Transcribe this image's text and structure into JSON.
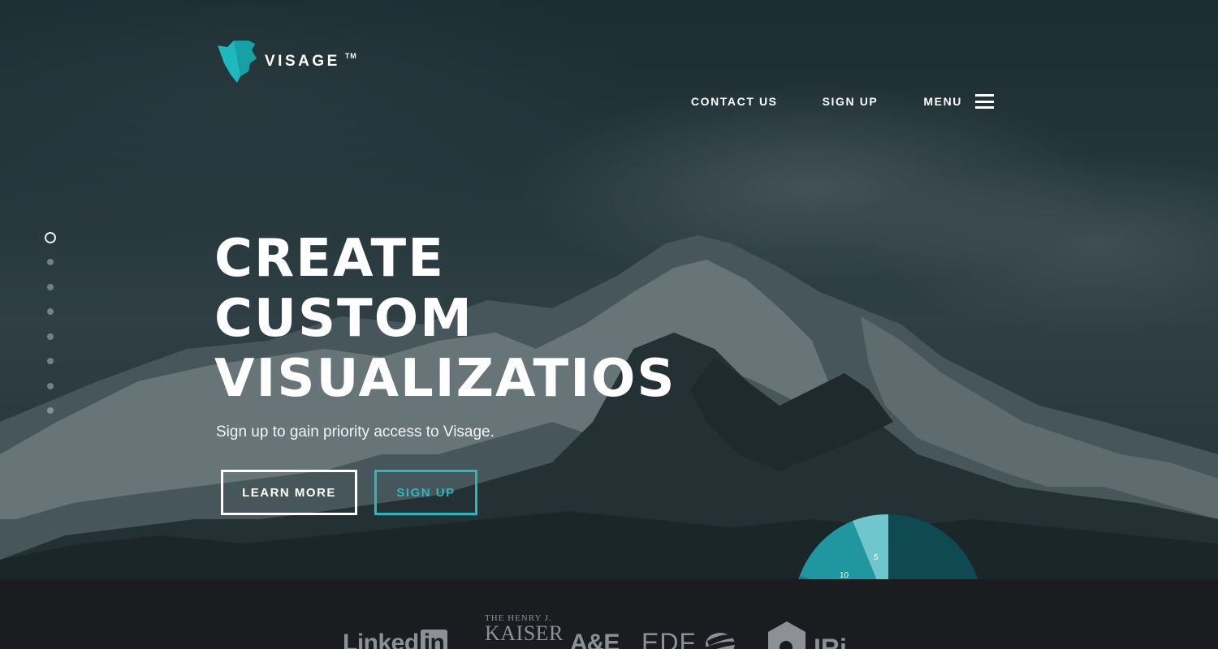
{
  "brand": {
    "name": "VISAGE",
    "trademark": "TM",
    "accent_color": "#2bb8bd"
  },
  "nav": {
    "contact_label": "CONTACT US",
    "signup_label": "SIGN UP",
    "menu_label": "MENU",
    "menu_icon": "hamburger-icon"
  },
  "slider": {
    "total_slides": 8,
    "active_index": 0
  },
  "hero": {
    "headline_lines": [
      "CREATE",
      "CUSTOM",
      "VISUALIZATIOS"
    ],
    "subline": "Sign up to gain priority access to Visage.",
    "learn_more_label": "LEARN MORE",
    "signup_label": "SIGN UP"
  },
  "pie_preview": {
    "labels": [
      "5",
      "10"
    ]
  },
  "partners": {
    "linkedin_text": "Linked",
    "linkedin_box": "in",
    "kaiser_line1": "THE HENRY J.",
    "kaiser_line2": "KAISER",
    "ae": "A&E",
    "edf": "EDF",
    "iri": "IRi"
  }
}
